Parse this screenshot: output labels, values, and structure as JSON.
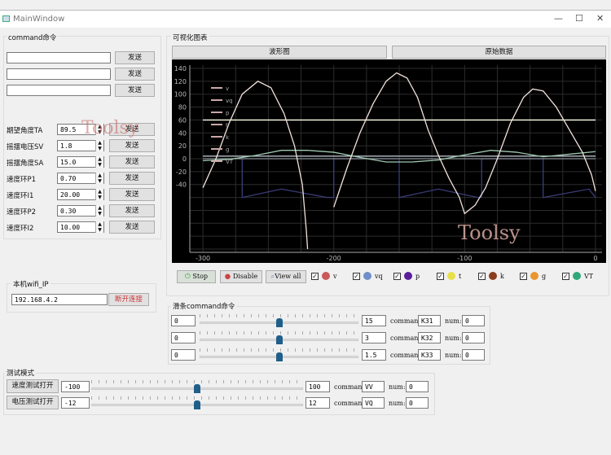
{
  "window": {
    "title": "MainWindow",
    "minimize": "—",
    "maximize": "☐",
    "close": "✕"
  },
  "command_group": {
    "title": "command命令",
    "send_buttons": [
      "发送",
      "发送",
      "发送"
    ],
    "inputs": [
      "",
      "",
      ""
    ]
  },
  "params": [
    {
      "label": "期望角度TA",
      "value": "89.5",
      "button": "发送"
    },
    {
      "label": "摇摆电压SV",
      "value": "1.8",
      "button": "发送"
    },
    {
      "label": "摇摆角度SA",
      "value": "15.0",
      "button": "发送"
    },
    {
      "label": "速度环P1",
      "value": "0.70",
      "button": "发送"
    },
    {
      "label": "速度环I1",
      "value": "20.00",
      "button": "发送"
    },
    {
      "label": "速度环P2",
      "value": "0.30",
      "button": "发送"
    },
    {
      "label": "速度环I2",
      "value": "10.00",
      "button": "发送"
    }
  ],
  "watermark": "Toolsy",
  "wifi": {
    "title": "本机wifi_IP",
    "ip": "192.168.4.2",
    "disconnect": "断开连接"
  },
  "chart_group": {
    "title": "可视化图表",
    "tabs": [
      "波形图",
      "原始数据"
    ]
  },
  "chart_data": {
    "type": "line",
    "xlim": [
      -310,
      5
    ],
    "ylim": [
      -145,
      145
    ],
    "x_ticks": [
      "-300",
      "-200",
      "-100",
      "0"
    ],
    "y_ticks": [
      "140",
      "120",
      "100",
      "80",
      "60",
      "40",
      "20",
      "0",
      "-20",
      "-40"
    ],
    "grid": true,
    "legend": "top-left",
    "legend_entries": [
      "v",
      "vq",
      "p",
      "t",
      "k",
      "g",
      "VT"
    ],
    "background": "#000000",
    "series": [
      {
        "name": "v",
        "color": "#f2e2dc",
        "x": [
          -300,
          -290,
          -280,
          -270,
          -258,
          -248,
          -238,
          -230,
          -224,
          -221,
          -220
        ],
        "y": [
          -45,
          0,
          55,
          100,
          120,
          110,
          70,
          20,
          -40,
          -110,
          -140
        ]
      },
      {
        "name": "v",
        "color": "#f2e2dc",
        "x": [
          -200,
          -190,
          -180,
          -170,
          -160,
          -152,
          -144,
          -136,
          -128,
          -120,
          -112,
          -104,
          -100,
          -92,
          -84,
          -75,
          -65,
          -55,
          -48,
          -40,
          -30,
          -20,
          -10,
          -3,
          0
        ],
        "y": [
          -75,
          -15,
          40,
          85,
          120,
          133,
          125,
          95,
          45,
          5,
          -30,
          -60,
          -85,
          -72,
          -45,
          0,
          55,
          95,
          108,
          105,
          80,
          45,
          10,
          -25,
          -50
        ]
      },
      {
        "name": "t",
        "color": "#ffffe8",
        "x": [
          -300,
          0
        ],
        "y": [
          60,
          60
        ]
      },
      {
        "name": "vq",
        "color": "#9ec8b0",
        "x": [
          -300,
          -280,
          -260,
          -240,
          -220,
          -200,
          -180,
          -160,
          -140,
          -120,
          -100,
          -80,
          -60,
          -40,
          -20,
          0
        ],
        "y": [
          -3,
          -1,
          5,
          13,
          13,
          10,
          2,
          -5,
          -5,
          -2,
          6,
          13,
          10,
          3,
          7,
          11
        ]
      },
      {
        "name": "p",
        "color": "#b8c0c8",
        "x": [
          -300,
          0
        ],
        "y": [
          4,
          4
        ]
      },
      {
        "name": "k",
        "color": "#8a8f95",
        "x": [
          -300,
          0
        ],
        "y": [
          0,
          0
        ]
      },
      {
        "name": "VT",
        "color": "#3a3d7a",
        "x": [
          -270,
          -270,
          -240,
          -205,
          -200,
          -200,
          -150,
          -150,
          -120,
          -90,
          -87,
          -87,
          -40,
          -40,
          -5,
          0
        ],
        "y": [
          0,
          -60,
          -47,
          -60,
          -60,
          0,
          0,
          -60,
          -47,
          -60,
          -60,
          0,
          0,
          -60,
          -47,
          -60
        ]
      }
    ]
  },
  "chart_controls": {
    "stop": "Stop",
    "disable": "Disable",
    "view_all": "View all",
    "toggles": [
      {
        "label": "v",
        "color": "#c85a5a"
      },
      {
        "label": "vq",
        "color": "#6e8fc8"
      },
      {
        "label": "p",
        "color": "#5a1e9a"
      },
      {
        "label": "t",
        "color": "#e8e04a"
      },
      {
        "label": "k",
        "color": "#8a3e1e"
      },
      {
        "label": "g",
        "color": "#e8962e"
      },
      {
        "label": "VT",
        "color": "#2ea878"
      }
    ]
  },
  "slider_group": {
    "title": "滑条command命令",
    "command_label": "command:",
    "num_label": "num:",
    "rows": [
      {
        "min": "0",
        "max": "15",
        "command": "K31",
        "num": "0",
        "position": 0.5
      },
      {
        "min": "0",
        "max": "3",
        "command": "K32",
        "num": "0",
        "position": 0.5
      },
      {
        "min": "0",
        "max": "1.5",
        "command": "K33",
        "num": "0",
        "position": 0.5
      }
    ]
  },
  "test_group": {
    "title": "测试模式",
    "command_label": "command:",
    "num_label": "num:",
    "rows": [
      {
        "button": "速度测试打开",
        "min": "-100",
        "max": "100",
        "command": "VV",
        "num": "0",
        "position": 0.5
      },
      {
        "button": "电压测试打开",
        "min": "-12",
        "max": "12",
        "command": "VQ",
        "num": "0",
        "position": 0.5
      }
    ]
  }
}
